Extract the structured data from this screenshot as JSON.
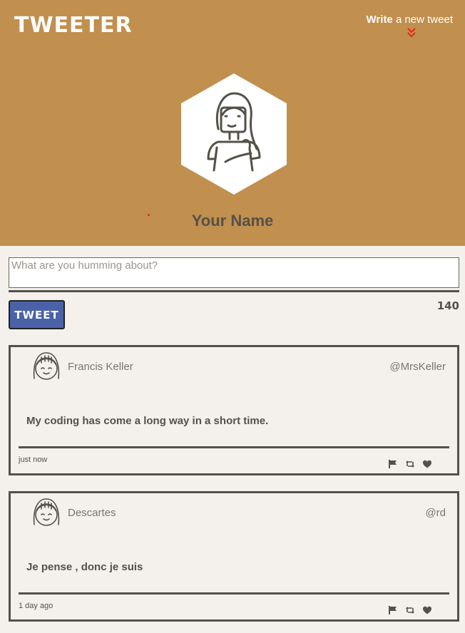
{
  "nav": {
    "logo": "TWEETER",
    "write_bold": "Write",
    "write_rest": " a new tweet"
  },
  "profile": {
    "name": "Your Name"
  },
  "composer": {
    "placeholder": "What are you humming about?",
    "value": "",
    "button_label": "TWEET",
    "char_count": "140"
  },
  "tweets": [
    {
      "name": "Francis Keller",
      "handle": "@MrsKeller",
      "text": "My coding has come a long way in a short time.",
      "time": "just now",
      "actions": [
        "flag-icon",
        "retweet-icon",
        "heart-icon"
      ]
    },
    {
      "name": "Descartes",
      "handle": "@rd",
      "text": "Je pense , donc je suis",
      "time": "1 day ago",
      "actions": [
        "flag-icon",
        "retweet-icon",
        "heart-icon"
      ]
    }
  ],
  "colors": {
    "header": "#c18f4e",
    "background": "#f4f1ec",
    "text": "#545149",
    "button": "#4a62a8",
    "accent": "#e02a1a"
  }
}
